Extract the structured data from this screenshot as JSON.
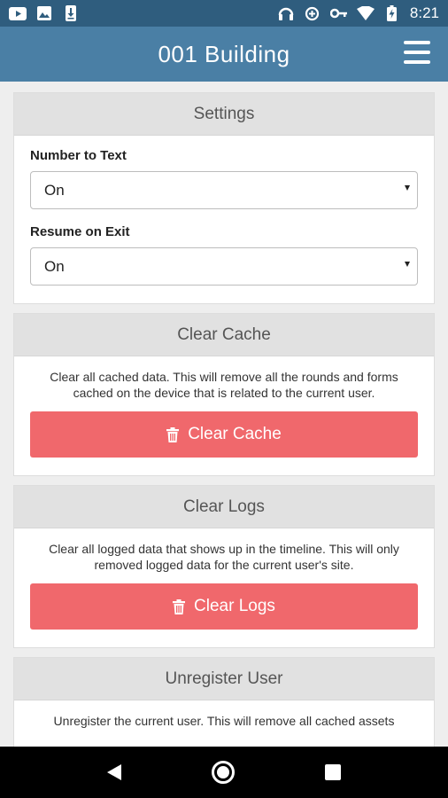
{
  "status_bar": {
    "time": "8:21",
    "left_icons": [
      "youtube-icon",
      "image-icon",
      "download-icon"
    ],
    "right_icons": [
      "headphones-icon",
      "data-saver-icon",
      "vpn-key-icon",
      "wifi-icon",
      "battery-charging-icon"
    ]
  },
  "app_bar": {
    "title": "001 Building",
    "menu_icon": "hamburger-menu-icon"
  },
  "settings": {
    "header": "Settings",
    "number_to_text_label": "Number to Text",
    "number_to_text_value": "On",
    "resume_on_exit_label": "Resume on Exit",
    "resume_on_exit_value": "On"
  },
  "clear_cache": {
    "header": "Clear Cache",
    "description": "Clear all cached data. This will remove all the rounds and forms cached on the device that is related to the current user.",
    "button_label": "Clear Cache"
  },
  "clear_logs": {
    "header": "Clear Logs",
    "description": "Clear all logged data that shows up in the timeline. This will only removed logged data for the current user's site.",
    "button_label": "Clear Logs"
  },
  "unregister": {
    "header": "Unregister User",
    "description": "Unregister the current user. This will remove all cached assets"
  },
  "nav_bar": {
    "icons": [
      "back-icon",
      "home-icon",
      "recents-icon"
    ]
  },
  "colors": {
    "status_bar": "#2f5d7e",
    "app_bar": "#4a7fa5",
    "danger": "#f0686c",
    "card_header": "#e1e1e1",
    "background": "#eeeeee"
  }
}
